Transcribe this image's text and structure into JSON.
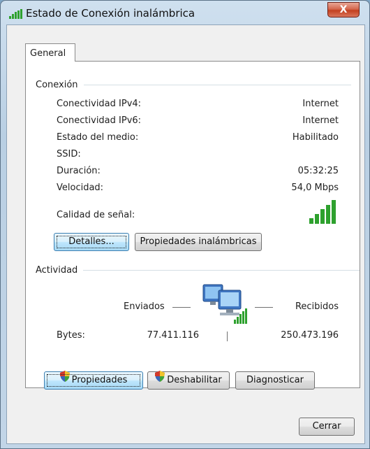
{
  "window": {
    "title": "Estado de Conexión inalámbrica",
    "close_label": "X"
  },
  "tabs": [
    {
      "label": "General"
    }
  ],
  "connection": {
    "heading": "Conexión",
    "rows": [
      {
        "label": "Conectividad IPv4:",
        "value": "Internet"
      },
      {
        "label": "Conectividad IPv6:",
        "value": "Internet"
      },
      {
        "label": "Estado del medio:",
        "value": "Habilitado"
      },
      {
        "label": "SSID:",
        "value": ""
      },
      {
        "label": "Duración:",
        "value": "05:32:25"
      },
      {
        "label": "Velocidad:",
        "value": "54,0 Mbps"
      }
    ],
    "signal_label": "Calidad de señal:",
    "signal_level": 5,
    "signal_max": 5,
    "signal_color": "#2ea12e",
    "details_button": "Detalles...",
    "wireless_props_button": "Propiedades inalámbricas"
  },
  "activity": {
    "heading": "Actividad",
    "sent_label": "Enviados",
    "received_label": "Recibidos",
    "bytes_label": "Bytes:",
    "bytes_sent": "77.411.116",
    "bytes_received": "250.473.196",
    "icon": "network-computers-icon"
  },
  "buttons": {
    "properties": "Propiedades",
    "disable": "Deshabilitar",
    "diagnose": "Diagnosticar",
    "close": "Cerrar"
  }
}
